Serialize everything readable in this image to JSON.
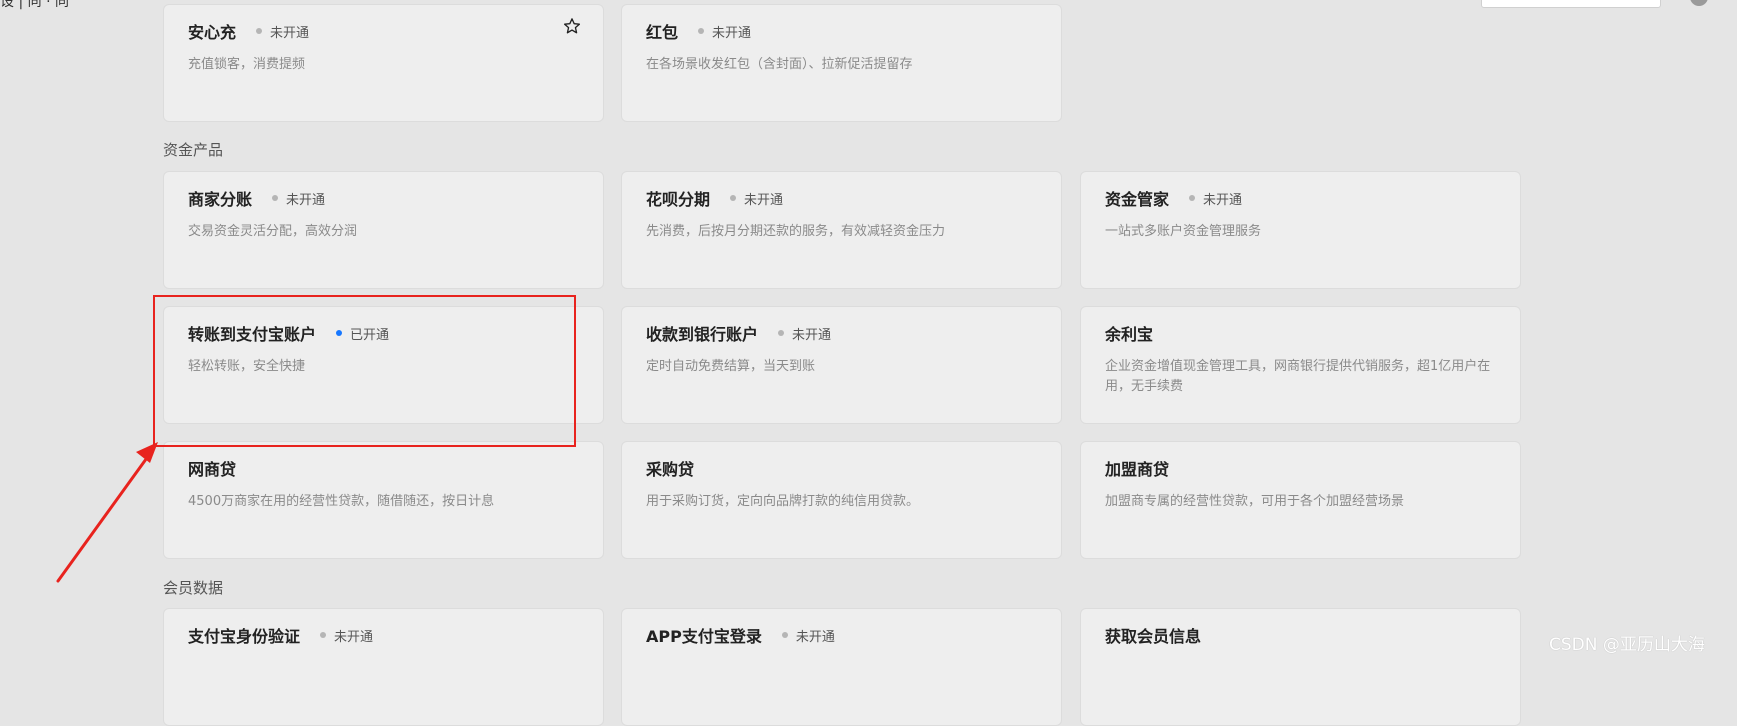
{
  "topbar": {
    "crumb": "设 | 同 · 同"
  },
  "sections": [
    {
      "title": "资金产品"
    },
    {
      "title": "会员数据"
    }
  ],
  "cards": {
    "anxinchong": {
      "title": "安心充",
      "status": "未开通",
      "desc": "充值锁客，消费提频"
    },
    "hongbao": {
      "title": "红包",
      "status": "未开通",
      "desc": "在各场景收发红包（含封面）、拉新促活提留存"
    },
    "shangjia_fenzhang": {
      "title": "商家分账",
      "status": "未开通",
      "desc": "交易资金灵活分配，高效分润"
    },
    "huabei_fenqi": {
      "title": "花呗分期",
      "status": "未开通",
      "desc": "先消费，后按月分期还款的服务，有效减轻资金压力"
    },
    "zijin_guanjia": {
      "title": "资金管家",
      "status": "未开通",
      "desc": "一站式多账户资金管理服务"
    },
    "zhuanzhang": {
      "title": "转账到支付宝账户",
      "status": "已开通",
      "desc": "轻松转账，安全快捷"
    },
    "shoukuan_yinhang": {
      "title": "收款到银行账户",
      "status": "未开通",
      "desc": "定时自动免费结算，当天到账"
    },
    "yulibao": {
      "title": "余利宝",
      "desc": "企业资金增值现金管理工具，网商银行提供代销服务，超1亿用户在用，无手续费"
    },
    "wangshangdai": {
      "title": "网商贷",
      "desc": "4500万商家在用的经营性贷款，随借随还，按日计息"
    },
    "caigoudai": {
      "title": "采购贷",
      "desc": "用于采购订货，定向向品牌打款的纯信用贷款。"
    },
    "jiameng_shangdai": {
      "title": "加盟商贷",
      "desc": "加盟商专属的经营性贷款，可用于各个加盟经营场景"
    },
    "shenfen_yanzheng": {
      "title": "支付宝身份验证",
      "status": "未开通"
    },
    "app_denglu": {
      "title": "APP支付宝登录",
      "status": "未开通"
    },
    "huiyuan_xinxi": {
      "title": "获取会员信息"
    }
  },
  "watermark": "CSDN @亚历山大海",
  "colors": {
    "accent": "#1677ff",
    "annotation": "#e8231e",
    "inactive_dot": "#b5b5b5"
  }
}
